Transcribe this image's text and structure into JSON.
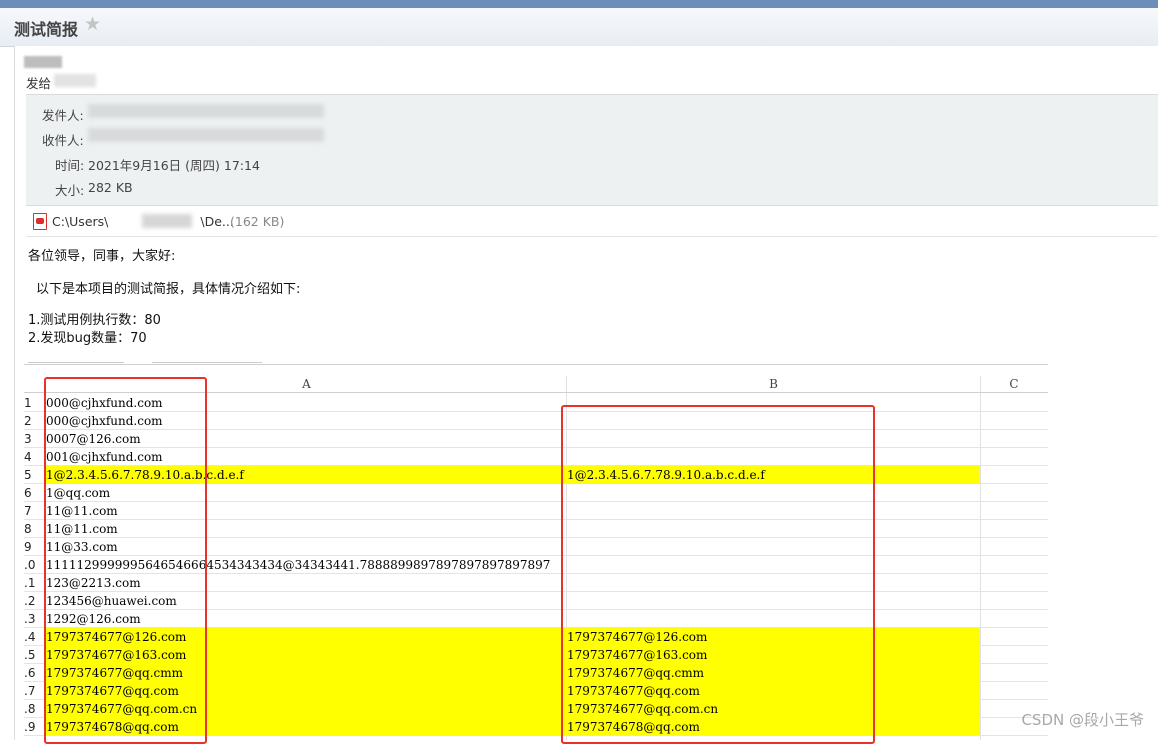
{
  "window": {
    "title": "测试简报"
  },
  "message": {
    "send_to_label": "发给",
    "from_label": "发件人:",
    "to_label": "收件人:",
    "time_label": "时间:",
    "time_value": "2021年9月16日 (周四) 17:14",
    "size_label": "大小:",
    "size_value": "282 KB",
    "attachment": {
      "path_start": "C:\\Users\\",
      "path_end": "\\De...",
      "size": "(162 KB)"
    },
    "body": {
      "greeting": "各位领导，同事，大家好:",
      "intro": "以下是本项目的测试简报，具体情况介绍如下:",
      "line1": "1.测试用例执行数：80",
      "line2": "2.发现bug数量：70"
    }
  },
  "sheet": {
    "columns": [
      "A",
      "B",
      "C"
    ],
    "rows": [
      {
        "num": "1",
        "a": "000@cjhxfund.com",
        "b": "",
        "hl": false
      },
      {
        "num": "2",
        "a": "000@cjhxfund.com",
        "b": "",
        "hl": false
      },
      {
        "num": "3",
        "a": "0007@126.com",
        "b": "",
        "hl": false
      },
      {
        "num": "4",
        "a": "001@cjhxfund.com",
        "b": "",
        "hl": false
      },
      {
        "num": "5",
        "a": "1@2.3.4.5.6.7.78.9.10.a.b.c.d.e.f",
        "b": "1@2.3.4.5.6.7.78.9.10.a.b.c.d.e.f",
        "hl": true
      },
      {
        "num": "6",
        "a": "1@qq.com",
        "b": "",
        "hl": false
      },
      {
        "num": "7",
        "a": "11@11.com",
        "b": "",
        "hl": false
      },
      {
        "num": "8",
        "a": "11@11.com",
        "b": "",
        "hl": false
      },
      {
        "num": "9",
        "a": "11@33.com",
        "b": "",
        "hl": false
      },
      {
        "num": ".0",
        "a": "1111129999995646546664534343434@34343441.7888899897897897897897897",
        "b": "",
        "hl": false
      },
      {
        "num": ".1",
        "a": "123@2213.com",
        "b": "",
        "hl": false
      },
      {
        "num": ".2",
        "a": "123456@huawei.com",
        "b": "",
        "hl": false
      },
      {
        "num": ".3",
        "a": "1292@126.com",
        "b": "",
        "hl": false
      },
      {
        "num": ".4",
        "a": "1797374677@126.com",
        "b": "1797374677@126.com",
        "hl": true
      },
      {
        "num": ".5",
        "a": "1797374677@163.com",
        "b": "1797374677@163.com",
        "hl": true
      },
      {
        "num": ".6",
        "a": "1797374677@qq.cmm",
        "b": "1797374677@qq.cmm",
        "hl": true
      },
      {
        "num": ".7",
        "a": "1797374677@qq.com",
        "b": "1797374677@qq.com",
        "hl": true
      },
      {
        "num": ".8",
        "a": "1797374677@qq.com.cn",
        "b": "1797374677@qq.com.cn",
        "hl": true
      },
      {
        "num": ".9",
        "a": "1797374678@qq.com",
        "b": "1797374678@qq.com",
        "hl": true
      }
    ],
    "highlight_color": "#ffff00",
    "box_color": "#e8322a"
  },
  "watermark": "CSDN @段小王爷"
}
